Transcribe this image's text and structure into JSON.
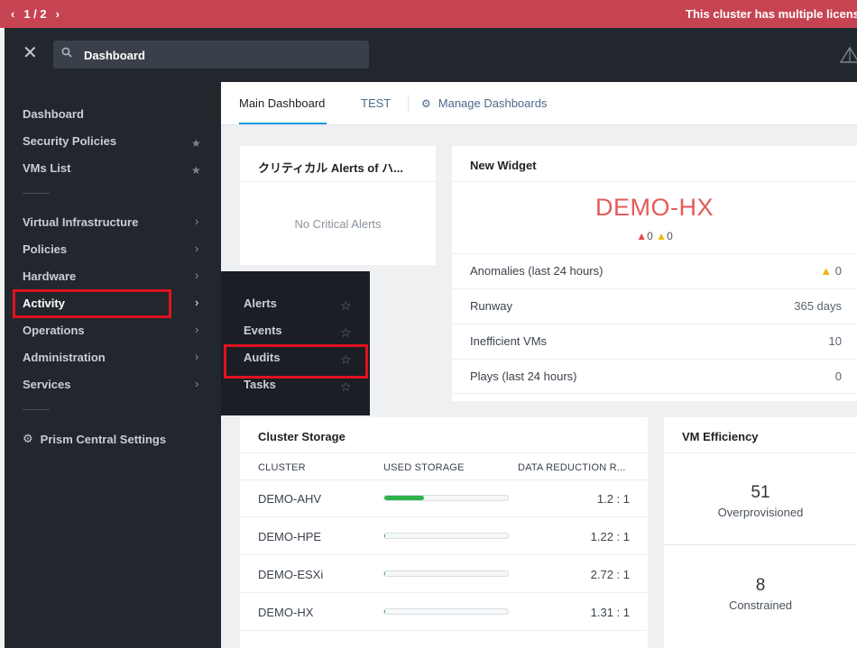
{
  "banner": {
    "pager": "1 / 2",
    "prev_icon": "chevron-left-icon",
    "next_icon": "chevron-right-icon",
    "message": "This cluster has multiple licensi"
  },
  "header": {
    "search_value": "Dashboard"
  },
  "sidebar": {
    "items": [
      {
        "label": "Dashboard"
      },
      {
        "label": "Security Policies",
        "starred": true
      },
      {
        "label": "VMs List",
        "starred": true
      },
      {
        "label": "Virtual Infrastructure",
        "submenu": true
      },
      {
        "label": "Policies",
        "submenu": true
      },
      {
        "label": "Hardware",
        "submenu": true
      },
      {
        "label": "Activity",
        "submenu": true,
        "active": true
      },
      {
        "label": "Operations",
        "submenu": true
      },
      {
        "label": "Administration",
        "submenu": true
      },
      {
        "label": "Services",
        "submenu": true
      }
    ],
    "settings_label": "Prism Central Settings"
  },
  "flyout": {
    "items": [
      {
        "label": "Alerts"
      },
      {
        "label": "Events"
      },
      {
        "label": "Audits",
        "highlighted": true
      },
      {
        "label": "Tasks"
      }
    ]
  },
  "tabs": {
    "main": "Main Dashboard",
    "test": "TEST",
    "manage": "Manage Dashboards"
  },
  "critical_card": {
    "title": "クリティカル Alerts of ハ...",
    "empty": "No Critical Alerts"
  },
  "new_widget": {
    "title": "New Widget",
    "cluster": "DEMO-HX",
    "critical_count": "0",
    "warning_count": "0",
    "rows": [
      {
        "label": "Anomalies (last 24 hours)",
        "value": "0",
        "warn_icon": true
      },
      {
        "label": "Runway",
        "value": "365 days"
      },
      {
        "label": "Inefficient VMs",
        "value": "10"
      },
      {
        "label": "Plays (last 24 hours)",
        "value": "0"
      }
    ]
  },
  "cluster_storage": {
    "title": "Cluster Storage",
    "headers": {
      "cluster": "CLUSTER",
      "used": "USED STORAGE",
      "reduction": "DATA REDUCTION R..."
    },
    "rows": [
      {
        "cluster": "DEMO-AHV",
        "used_pct": 32,
        "ratio": "1.2 : 1"
      },
      {
        "cluster": "DEMO-HPE",
        "used_pct": 1,
        "ratio": "1.22 : 1"
      },
      {
        "cluster": "DEMO-ESXi",
        "used_pct": 1,
        "ratio": "2.72 : 1"
      },
      {
        "cluster": "DEMO-HX",
        "used_pct": 1,
        "ratio": "1.31 : 1"
      }
    ]
  },
  "vm_efficiency": {
    "title": "VM Efficiency",
    "overprovisioned_count": "51",
    "overprovisioned_label": "Overprovisioned",
    "constrained_count": "8",
    "constrained_label": "Constrained"
  },
  "colors": {
    "banner": "#c64452",
    "sidebar": "#22272e",
    "highlight": "#e0121f",
    "accent": "#1b9ae0",
    "critical": "#e35b5b",
    "warning": "#f2b60c",
    "bar_fill": "#2cb34a"
  }
}
